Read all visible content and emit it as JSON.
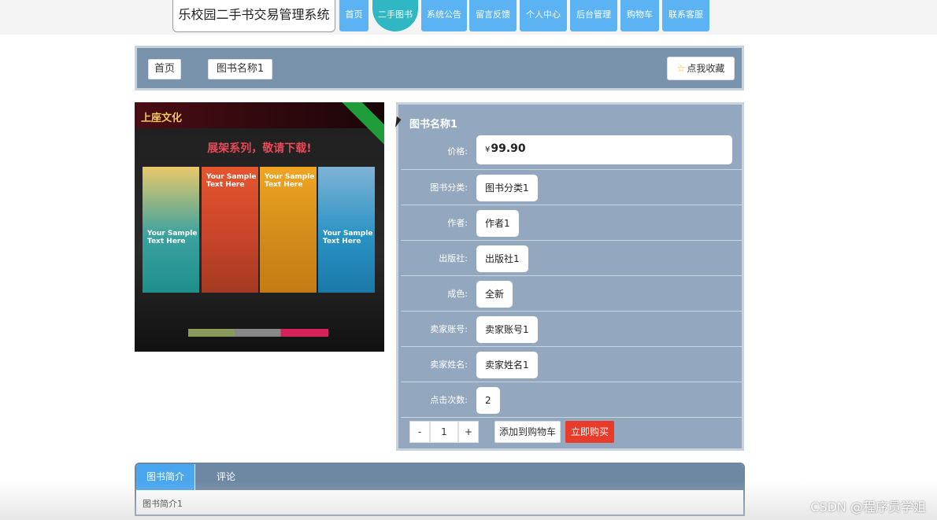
{
  "header": {
    "site_title": "乐校园二手书交易管理系统",
    "nav": [
      {
        "label": "首页"
      },
      {
        "label": "二手图书",
        "active": true
      },
      {
        "label": "系统公告"
      },
      {
        "label": "留言反馈"
      },
      {
        "label": "个人中心"
      },
      {
        "label": "后台管理"
      },
      {
        "label": "购物车"
      },
      {
        "label": "联系客服"
      }
    ]
  },
  "breadcrumb": {
    "home": "首页",
    "current": "图书名称1",
    "favorite_label": "点我收藏"
  },
  "product": {
    "image": {
      "logo_text": "上座文化",
      "headline": "展架系列，敬请下载!",
      "panel_text": "Your Sample Text Here"
    },
    "title": "图书名称1",
    "price_label": "价格:",
    "currency": "¥",
    "price": "99.90",
    "fields": [
      {
        "label": "图书分类:",
        "value": "图书分类1"
      },
      {
        "label": "作者:",
        "value": "作者1"
      },
      {
        "label": "出版社:",
        "value": "出版社1"
      },
      {
        "label": "成色:",
        "value": "全新"
      },
      {
        "label": "卖家账号:",
        "value": "卖家账号1"
      },
      {
        "label": "卖家姓名:",
        "value": "卖家姓名1"
      },
      {
        "label": "点击次数:",
        "value": "2"
      }
    ],
    "quantity": "1",
    "minus": "-",
    "plus": "+",
    "add_to_cart": "添加到购物车",
    "buy_now": "立即购买"
  },
  "tabs": {
    "items": [
      {
        "label": "图书简介",
        "active": true
      },
      {
        "label": "评论"
      }
    ],
    "content": "图书简介1"
  },
  "watermark": "CSDN @程序员学姐",
  "colors": {
    "nav_blue": "#5cb3f3",
    "nav_active": "#2fb7c4",
    "panel_gray_blue": "#93a8be",
    "buy_red": "#e83b2a"
  }
}
